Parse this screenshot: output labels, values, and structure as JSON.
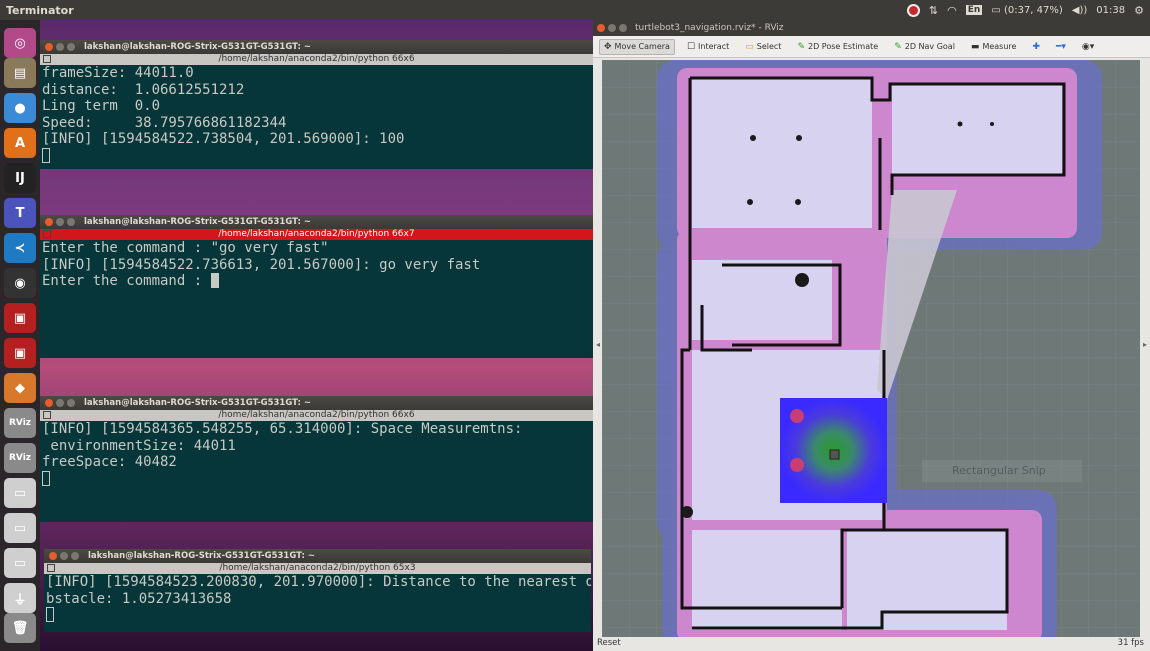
{
  "top_panel": {
    "app_title": "Terminator",
    "keyboard": "En",
    "battery": "(0:37, 47%)",
    "volume": "◀))",
    "clock": "01:38"
  },
  "launcher": {
    "items": [
      {
        "name": "ubuntu-dash",
        "label": "◎",
        "color": "#b24a8a"
      },
      {
        "name": "files",
        "label": "▤",
        "color": "#8a7a5a"
      },
      {
        "name": "chrome",
        "label": "●",
        "color": "#3a8ad8"
      },
      {
        "name": "software-center",
        "label": "A",
        "color": "#e0701a"
      },
      {
        "name": "intellij",
        "label": "IJ",
        "color": "#222222"
      },
      {
        "name": "teams",
        "label": "T",
        "color": "#4b53bc"
      },
      {
        "name": "vscode",
        "label": "≺",
        "color": "#1f7ac4"
      },
      {
        "name": "obs",
        "label": "◉",
        "color": "#333333"
      },
      {
        "name": "terminator-1",
        "label": "▣",
        "color": "#b42020"
      },
      {
        "name": "terminator-2",
        "label": "▣",
        "color": "#b42020"
      },
      {
        "name": "package",
        "label": "◆",
        "color": "#d8782a"
      },
      {
        "name": "rviz-1",
        "label": "RViz",
        "color": "#8a8a8a"
      },
      {
        "name": "rviz-2",
        "label": "RViz",
        "color": "#8a8a8a"
      },
      {
        "name": "drive-1",
        "label": "▭",
        "color": "#cfcfcf"
      },
      {
        "name": "drive-2",
        "label": "▭",
        "color": "#cfcfcf"
      },
      {
        "name": "drive-3",
        "label": "▭",
        "color": "#cfcfcf"
      },
      {
        "name": "usb",
        "label": "⏚",
        "color": "#cfcfcf"
      },
      {
        "name": "trash",
        "label": "🗑",
        "color": "#8a8a8a"
      }
    ]
  },
  "terminals": [
    {
      "title": "lakshan@lakshan-ROG-Strix-G531GT-G531GT: ~",
      "tab": "/home/lakshan/anaconda2/bin/python 66x6",
      "active": false,
      "lines": [
        "frameSize: 44011.0",
        "distance:  1.06612551212",
        "Ling term  0.0",
        "Speed:     38.795766861182344",
        "[INFO] [1594584522.738504, 201.569000]: 100"
      ]
    },
    {
      "title": "lakshan@lakshan-ROG-Strix-G531GT-G531GT: ~",
      "tab": "/home/lakshan/anaconda2/bin/python 66x7",
      "active": true,
      "lines": [
        "Enter the command : \"go very fast\"",
        "[INFO] [1594584522.736613, 201.567000]: go very fast",
        "Enter the command : "
      ]
    },
    {
      "title": "lakshan@lakshan-ROG-Strix-G531GT-G531GT: ~",
      "tab": "/home/lakshan/anaconda2/bin/python 66x6",
      "active": false,
      "lines": [
        "[INFO] [1594584365.548255, 65.314000]: Space Measuremtns:",
        " environmentSize: 44011",
        "freeSpace: 40482"
      ]
    },
    {
      "title": "lakshan@lakshan-ROG-Strix-G531GT-G531GT: ~",
      "tab": "/home/lakshan/anaconda2/bin/python 65x3",
      "active": false,
      "lines": [
        "[INFO] [1594584523.200830, 201.970000]: Distance to the nearest o",
        "bstacle: 1.05273413658"
      ]
    }
  ],
  "rviz": {
    "window_title": "turtlebot3_navigation.rviz* - RViz",
    "tools": [
      "Move Camera",
      "Interact",
      "Select",
      "2D Pose Estimate",
      "2D Nav Goal",
      "Measure"
    ],
    "overlay": "Rectangular Snip",
    "reset": "Reset",
    "fps": "31 fps"
  }
}
